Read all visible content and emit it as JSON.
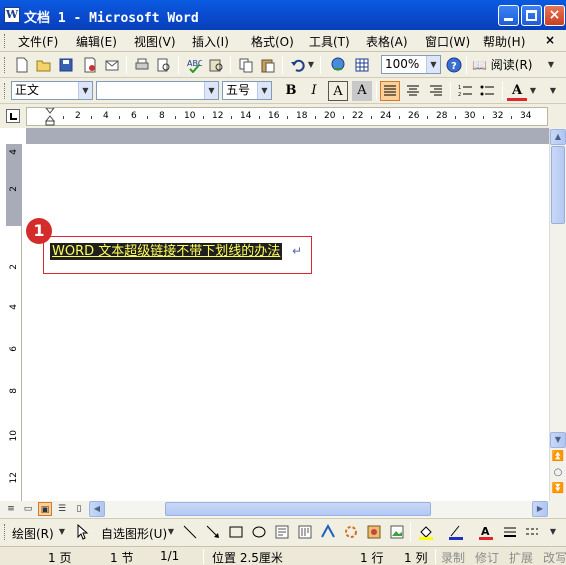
{
  "window": {
    "title": "文档 1 - Microsoft Word",
    "app_icon": "W",
    "close_glyph": "×"
  },
  "menu": {
    "items": [
      "文件(F)",
      "编辑(E)",
      "视图(V)",
      "插入(I)",
      "格式(O)",
      "工具(T)",
      "表格(A)",
      "窗口(W)",
      "帮助(H)"
    ],
    "close_glyph": "×"
  },
  "standard_toolbar": {
    "zoom": "100%",
    "read_label": "阅读(R)"
  },
  "format_toolbar": {
    "style": "正文",
    "font": "",
    "size": "五号",
    "bold": "B",
    "italic": "I",
    "char_border": "A",
    "char_shading": "A",
    "font_color_glyph": "A",
    "font_color": "#e0252e"
  },
  "ruler": {
    "numbers": [
      "2",
      "4",
      "6",
      "8",
      "10",
      "12",
      "14",
      "16",
      "18",
      "20",
      "22",
      "24",
      "26",
      "28",
      "30",
      "32",
      "34"
    ],
    "vertical_numbers": [
      "4",
      "2",
      "2",
      "4",
      "6",
      "8",
      "10",
      "12"
    ]
  },
  "document": {
    "hyperlink_text": "WORD 文本超级链接不带下划线的办法",
    "paragraph_mark": "↵",
    "step_badge": "1"
  },
  "drawing_toolbar": {
    "draw_label": "绘图(R)",
    "autoshapes_label": "自选图形(U)"
  },
  "status": {
    "page": "1 页",
    "section": "1 节",
    "page_of": "1/1",
    "position": "位置 2.5厘米",
    "line": "1 行",
    "column": "1 列",
    "rec": "录制",
    "trk": "修订",
    "ext": "扩展",
    "ovr": "改写"
  },
  "colors": {
    "title_bar": "#0a4bd0",
    "highlight": "#1f1f1f",
    "hyperlink_text": "#ffff58",
    "annotation_red": "#e0252e"
  }
}
